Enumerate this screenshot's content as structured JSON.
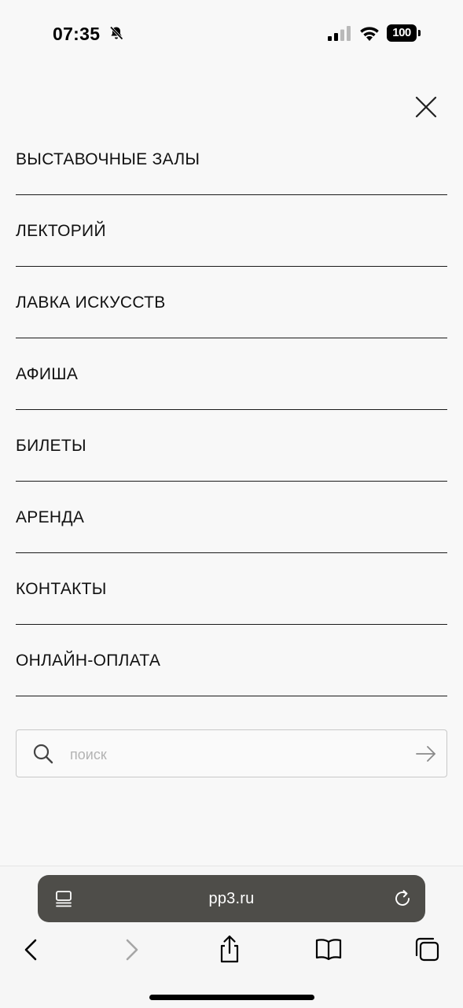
{
  "status_bar": {
    "time": "07:35",
    "battery": "100"
  },
  "menu": {
    "items": [
      {
        "label": "ВЫСТАВОЧНЫЕ ЗАЛЫ"
      },
      {
        "label": "ЛЕКТОРИЙ"
      },
      {
        "label": "ЛАВКА ИСКУССТВ"
      },
      {
        "label": "АФИША"
      },
      {
        "label": "БИЛЕТЫ"
      },
      {
        "label": "АРЕНДА"
      },
      {
        "label": "КОНТАКТЫ"
      },
      {
        "label": "ОНЛАЙН-ОПЛАТА"
      }
    ]
  },
  "search": {
    "placeholder": "поиск",
    "value": ""
  },
  "browser": {
    "url": "pp3.ru"
  },
  "icons": {
    "close": "close-icon",
    "search": "search-icon",
    "submit": "arrow-right-icon",
    "reader": "reader-mode-icon",
    "reload": "reload-icon",
    "back": "chevron-left-icon",
    "forward": "chevron-right-icon",
    "share": "share-icon",
    "bookmarks": "book-icon",
    "tabs": "tabs-icon"
  },
  "colors": {
    "background": "#f8f8f8",
    "text": "#111111",
    "address_bar": "#4e4d49",
    "toolbar_icon": "#000000",
    "toolbar_icon_disabled": "#a6a6a6"
  }
}
